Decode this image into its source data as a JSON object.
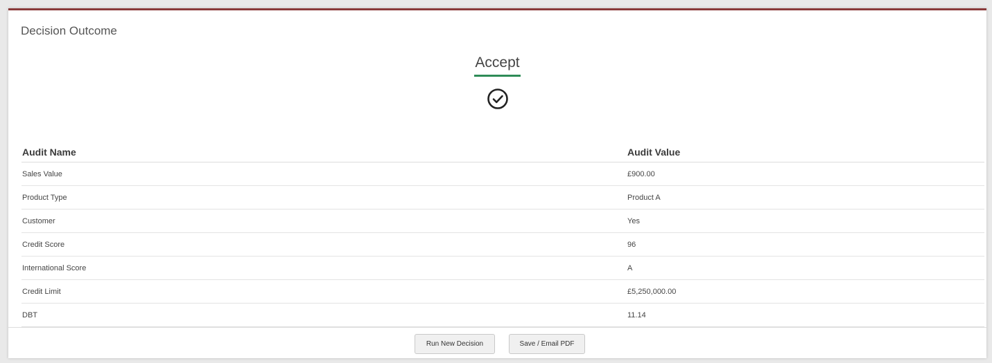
{
  "panel": {
    "title": "Decision Outcome"
  },
  "outcome": {
    "label": "Accept",
    "icon": "check-circle-icon",
    "accent_color": "#2e8b57"
  },
  "table": {
    "headers": {
      "name": "Audit Name",
      "value": "Audit Value"
    },
    "rows": [
      {
        "name": "Sales Value",
        "value": "£900.00"
      },
      {
        "name": "Product Type",
        "value": "Product A"
      },
      {
        "name": "Customer",
        "value": "Yes"
      },
      {
        "name": "Credit Score",
        "value": "96"
      },
      {
        "name": "International Score",
        "value": "A"
      },
      {
        "name": "Credit Limit",
        "value": "£5,250,000.00"
      },
      {
        "name": "DBT",
        "value": "11.14"
      }
    ]
  },
  "actions": {
    "run_new_decision": "Run New Decision",
    "save_email_pdf": "Save / Email PDF"
  }
}
